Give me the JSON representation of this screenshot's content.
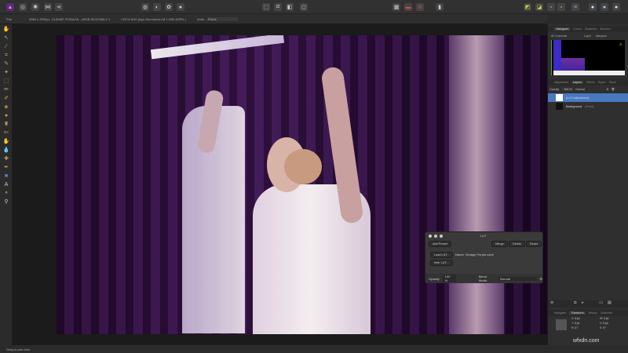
{
  "toolbar": {
    "personas": [
      "photo-persona",
      "liquify-persona",
      "develop-persona",
      "tone-mapping-persona",
      "export-persona"
    ]
  },
  "context": {
    "tool": "Pan",
    "doc_info": "5984 x 3992px, 23.89MP, RGBA/16 - sRGB IEC61966-2.1",
    "camera": "LEICA M10 (Apo-Summicron-M 1:2/50 ASPH.)",
    "units_label": "Units:",
    "units_value": "Pixels"
  },
  "histogram": {
    "tabs": [
      "Histogram",
      "Colour",
      "Swatches",
      "Brushes"
    ],
    "channel": "All Channels",
    "layer_label": "Layer",
    "marquee_label": "Marquee"
  },
  "layers": {
    "tabs": [
      "Adjustment",
      "Layers",
      "Effects",
      "Styles",
      "Stock"
    ],
    "opacity_label": "Opacity:",
    "opacity": "100 %",
    "blend": "Normal",
    "items": [
      {
        "name": "(LUT Adjustment)"
      },
      {
        "name": "Background",
        "type": "(Pixel)"
      }
    ]
  },
  "transform": {
    "tabs": [
      "Navigator",
      "Transform",
      "History",
      "Channels"
    ],
    "fields": [
      {
        "label": "X:",
        "value": "0 px"
      },
      {
        "label": "W:",
        "value": "0 px"
      },
      {
        "label": "Y:",
        "value": "0 px"
      },
      {
        "label": "H:",
        "value": "0 px"
      },
      {
        "label": "R:",
        "value": "0 °"
      },
      {
        "label": "S:",
        "value": "0 °"
      }
    ]
  },
  "lut": {
    "title": "LUT",
    "add_preset": "Add Preset",
    "merge": "Merge",
    "delete": "Delete",
    "reset": "Reset",
    "load": "Load LUT...",
    "infer": "Infer LUT...",
    "name": "Name: Vintage Purple.cube",
    "opacity_label": "Opacity:",
    "opacity": "100 %",
    "blend_label": "Blend Mode:",
    "blend": "Normal"
  },
  "status": "Drag to pan view.",
  "watermark": "wfxdn.com"
}
